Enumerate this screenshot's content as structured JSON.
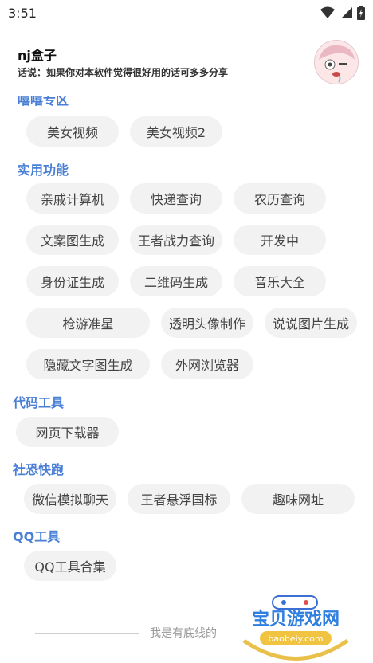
{
  "status": {
    "time": "3:51"
  },
  "header": {
    "title": "nj盒子",
    "subtitle": "话说：如果你对本软件觉得很好用的话可多多分享"
  },
  "sections": {
    "special": {
      "title": "嘻嘻专区",
      "items": [
        "美女视频",
        "美女视频2"
      ]
    },
    "practical": {
      "title": "实用功能",
      "items": [
        "亲戚计算机",
        "快递查询",
        "农历查询",
        "文案图生成",
        "王者战力查询",
        "开发中",
        "身份证生成",
        "二维码生成",
        "音乐大全",
        "枪游准星",
        "透明头像制作",
        "说说图片生成",
        "隐藏文字图生成",
        "外网浏览器"
      ]
    },
    "code": {
      "title": "代码工具",
      "items": [
        "网页下载器"
      ]
    },
    "social": {
      "title": "社恐快跑",
      "items": [
        "微信模拟聊天",
        "王者悬浮国标",
        "趣味网址"
      ]
    },
    "qq": {
      "title": "QQ工具",
      "items": [
        "QQ工具合集"
      ]
    }
  },
  "footer": {
    "text": "我是有底线的"
  },
  "watermark": {
    "brand": "宝贝游戏网",
    "domain": "baobeiy.com"
  }
}
